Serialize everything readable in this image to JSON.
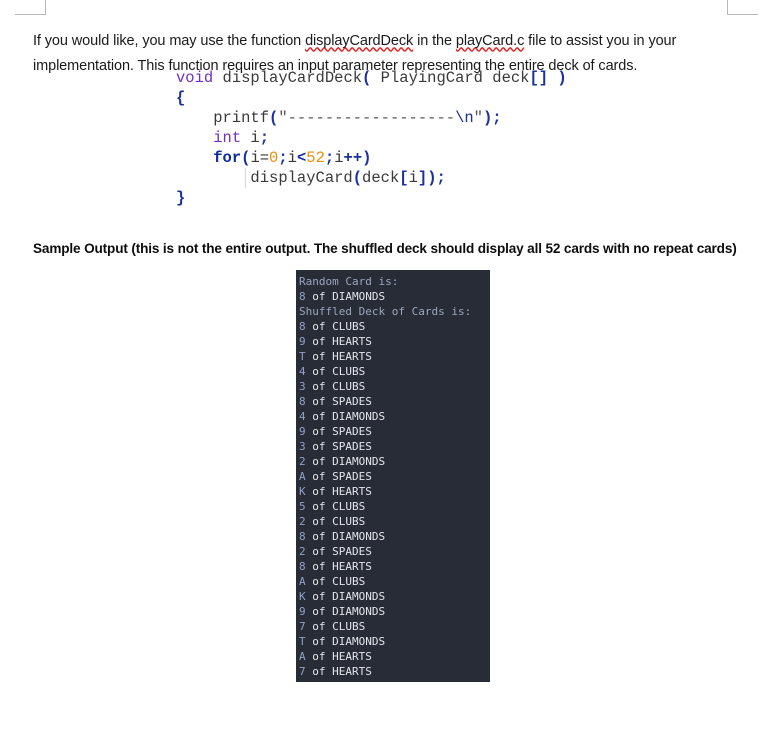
{
  "intro": {
    "before_fn": "If you would like, you may use the function ",
    "fn_name": "displayCardDeck",
    "mid": " in the ",
    "file_name": "playCard.c",
    "after_file": " file to assist you in your implementation.   This function requires an input parameter representing the entire deck of cards."
  },
  "code": {
    "lines": [
      {
        "tokens": [
          {
            "t": "void",
            "c": "k-type"
          },
          {
            "t": " displayCardDeck",
            "c": "plain"
          },
          {
            "t": "(",
            "c": "punct"
          },
          {
            "t": " PlayingCard deck",
            "c": "plain"
          },
          {
            "t": "[]",
            "c": "punct"
          },
          {
            "t": " )",
            "c": "punct"
          }
        ]
      },
      {
        "tokens": [
          {
            "t": "{",
            "c": "punct"
          }
        ]
      },
      {
        "indent_guide": false,
        "tokens": [
          {
            "t": "    printf",
            "c": "plain"
          },
          {
            "t": "(",
            "c": "punct"
          },
          {
            "t": "\"------------------",
            "c": "str"
          },
          {
            "t": "\\n",
            "c": "esc"
          },
          {
            "t": "\"",
            "c": "str"
          },
          {
            "t": ");",
            "c": "punct"
          }
        ]
      },
      {
        "tokens": [
          {
            "t": "    ",
            "c": "plain"
          },
          {
            "t": "int",
            "c": "k-type"
          },
          {
            "t": " i",
            "c": "plain"
          },
          {
            "t": ";",
            "c": "punct"
          }
        ]
      },
      {
        "tokens": [
          {
            "t": "    ",
            "c": "plain"
          },
          {
            "t": "for",
            "c": "k-ctrl"
          },
          {
            "t": "(",
            "c": "punct"
          },
          {
            "t": "i=",
            "c": "plain"
          },
          {
            "t": "0",
            "c": "num"
          },
          {
            "t": ";",
            "c": "punct"
          },
          {
            "t": "i",
            "c": "plain"
          },
          {
            "t": "<",
            "c": "punct"
          },
          {
            "t": "52",
            "c": "num"
          },
          {
            "t": ";",
            "c": "punct"
          },
          {
            "t": "i",
            "c": "plain"
          },
          {
            "t": "++)",
            "c": "punct"
          }
        ]
      },
      {
        "indent_guide": true,
        "tokens": [
          {
            "t": "        displayCard",
            "c": "plain"
          },
          {
            "t": "(",
            "c": "punct"
          },
          {
            "t": "deck",
            "c": "plain"
          },
          {
            "t": "[",
            "c": "punct"
          },
          {
            "t": "i",
            "c": "plain"
          },
          {
            "t": "]",
            "c": "punct"
          },
          {
            "t": ");",
            "c": "punct"
          }
        ]
      },
      {
        "tokens": [
          {
            "t": "}",
            "c": "punct"
          }
        ]
      }
    ]
  },
  "caption": "Sample Output (this is not the entire output.  The shuffled deck should display all 52 cards with no repeat cards)",
  "terminal": {
    "background": "#282c36",
    "text_color": "#d7dae0",
    "header_color": "#9aa6bd",
    "rank_color": "#8fa3c8",
    "lines": [
      {
        "type": "header",
        "text": "Random Card is:"
      },
      {
        "type": "card",
        "rank": "8",
        "suit": "DIAMONDS"
      },
      {
        "type": "header",
        "text": "Shuffled Deck of Cards is:"
      },
      {
        "type": "card",
        "rank": "8",
        "suit": "CLUBS"
      },
      {
        "type": "card",
        "rank": "9",
        "suit": "HEARTS"
      },
      {
        "type": "card",
        "rank": "T",
        "suit": "HEARTS"
      },
      {
        "type": "card",
        "rank": "4",
        "suit": "CLUBS"
      },
      {
        "type": "card",
        "rank": "3",
        "suit": "CLUBS"
      },
      {
        "type": "card",
        "rank": "8",
        "suit": "SPADES"
      },
      {
        "type": "card",
        "rank": "4",
        "suit": "DIAMONDS"
      },
      {
        "type": "card",
        "rank": "9",
        "suit": "SPADES"
      },
      {
        "type": "card",
        "rank": "3",
        "suit": "SPADES"
      },
      {
        "type": "card",
        "rank": "2",
        "suit": "DIAMONDS"
      },
      {
        "type": "card",
        "rank": "A",
        "suit": "SPADES"
      },
      {
        "type": "card",
        "rank": "K",
        "suit": "HEARTS"
      },
      {
        "type": "card",
        "rank": "5",
        "suit": "CLUBS"
      },
      {
        "type": "card",
        "rank": "2",
        "suit": "CLUBS"
      },
      {
        "type": "card",
        "rank": "8",
        "suit": "DIAMONDS"
      },
      {
        "type": "card",
        "rank": "2",
        "suit": "SPADES"
      },
      {
        "type": "card",
        "rank": "8",
        "suit": "HEARTS"
      },
      {
        "type": "card",
        "rank": "A",
        "suit": "CLUBS"
      },
      {
        "type": "card",
        "rank": "K",
        "suit": "DIAMONDS"
      },
      {
        "type": "card",
        "rank": "9",
        "suit": "DIAMONDS"
      },
      {
        "type": "card",
        "rank": "7",
        "suit": "CLUBS"
      },
      {
        "type": "card",
        "rank": "T",
        "suit": "DIAMONDS"
      },
      {
        "type": "card",
        "rank": "A",
        "suit": "HEARTS"
      },
      {
        "type": "card",
        "rank": "7",
        "suit": "HEARTS"
      }
    ]
  }
}
